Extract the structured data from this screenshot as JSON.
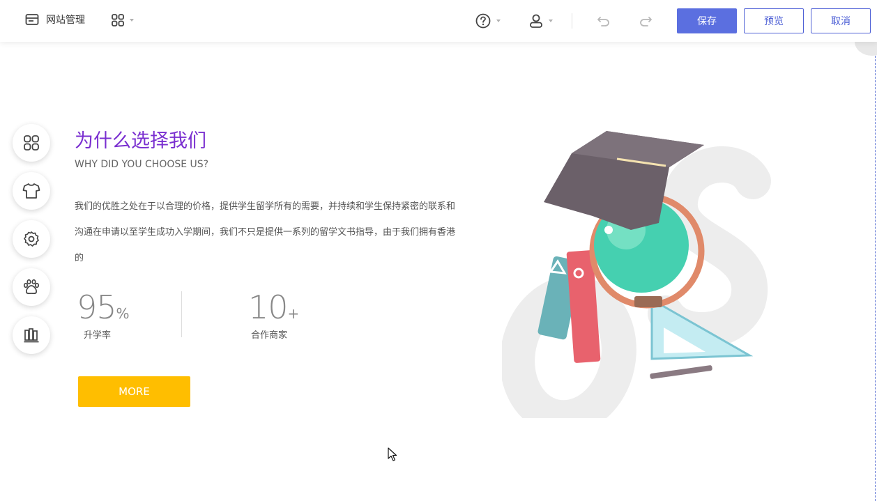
{
  "toolbar": {
    "site_mgmt_label": "网站管理",
    "save_label": "保存",
    "preview_label": "预览",
    "cancel_label": "取消",
    "accent_color": "#5b6fe0"
  },
  "sidebar_tools": [
    {
      "icon": "grid-icon"
    },
    {
      "icon": "shirt-icon"
    },
    {
      "icon": "settings-icon"
    },
    {
      "icon": "paw-icon"
    },
    {
      "icon": "books-icon"
    }
  ],
  "content": {
    "title_cn": "为什么选择我们",
    "title_en": "WHY DID YOU CHOOSE US?",
    "title_color": "#7a2fd0",
    "paragraph": "我们的优胜之处在于以合理的价格，提供学生留学所有的需要，并持续和学生保持紧密的联系和沟通在申请以至学生成功入学期间，我们不只是提供一系列的留学文书指导，由于我们拥有香港的",
    "stats": [
      {
        "value": "95",
        "unit": "%",
        "label": "升学率"
      },
      {
        "value": "10",
        "unit": "+",
        "label": "合作商家"
      }
    ],
    "more_label": "MORE",
    "more_color": "#ffbe00"
  }
}
